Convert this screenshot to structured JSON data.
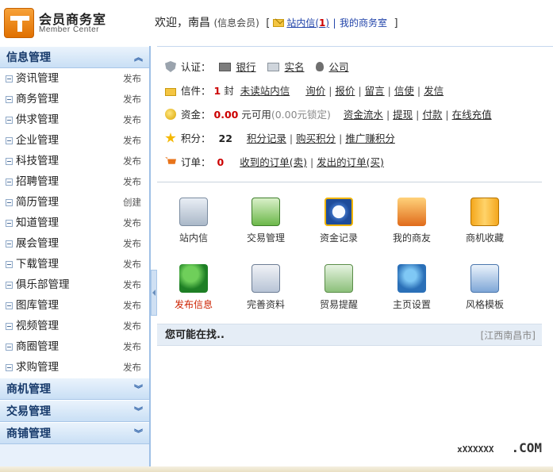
{
  "header": {
    "logo_title": "会员商务室",
    "logo_sub": "Member Center",
    "welcome_prefix": "欢迎，",
    "username": "南昌",
    "role": "(信息会员)",
    "bracket_open": "[",
    "bracket_close": "]",
    "inbox_label": "站内信(",
    "inbox_count": "1",
    "inbox_close": ")",
    "sep": "|",
    "office_link": "我的商务室"
  },
  "sidebar": {
    "sections": [
      {
        "title": "信息管理",
        "expanded": true,
        "items": [
          {
            "label": "资讯管理",
            "action": "发布"
          },
          {
            "label": "商务管理",
            "action": "发布"
          },
          {
            "label": "供求管理",
            "action": "发布"
          },
          {
            "label": "企业管理",
            "action": "发布"
          },
          {
            "label": "科技管理",
            "action": "发布"
          },
          {
            "label": "招聘管理",
            "action": "发布"
          },
          {
            "label": "简历管理",
            "action": "创建"
          },
          {
            "label": "知道管理",
            "action": "发布"
          },
          {
            "label": "展会管理",
            "action": "发布"
          },
          {
            "label": "下载管理",
            "action": "发布"
          },
          {
            "label": "俱乐部管理",
            "action": "发布"
          },
          {
            "label": "图库管理",
            "action": "发布"
          },
          {
            "label": "视频管理",
            "action": "发布"
          },
          {
            "label": "商圈管理",
            "action": "发布"
          },
          {
            "label": "求购管理",
            "action": "发布"
          }
        ]
      },
      {
        "title": "商机管理",
        "expanded": false
      },
      {
        "title": "交易管理",
        "expanded": false
      },
      {
        "title": "商铺管理",
        "expanded": false
      }
    ]
  },
  "account": {
    "cert": {
      "label": "认证：",
      "links": [
        "银行",
        "实名",
        "公司"
      ]
    },
    "mail": {
      "label": "信件：",
      "count": "1",
      "unit": "封",
      "links": [
        "未读站内信",
        "询价",
        "报价",
        "留言",
        "信使",
        "发信"
      ]
    },
    "funds": {
      "label": "资金：",
      "amount": "0.00",
      "unit": "元可用",
      "locked": "(0.00元锁定)",
      "links": [
        "资金流水",
        "提现",
        "付款",
        "在线充值"
      ]
    },
    "points": {
      "label": "积分：",
      "value": "22",
      "links": [
        "积分记录",
        "购买积分",
        "推广赚积分"
      ]
    },
    "orders": {
      "label": "订单：",
      "count": "0",
      "links": [
        "收到的订单(卖)",
        "发出的订单(买)"
      ]
    }
  },
  "tiles": [
    {
      "label": "站内信",
      "icon": "inbox-icon"
    },
    {
      "label": "交易管理",
      "icon": "trade-icon"
    },
    {
      "label": "资金记录",
      "icon": "money-clock-icon"
    },
    {
      "label": "我的商友",
      "icon": "friends-icon"
    },
    {
      "label": "商机收藏",
      "icon": "cabinet-icon"
    },
    {
      "label": "发布信息",
      "icon": "publish-user-icon"
    },
    {
      "label": "完善资料",
      "icon": "profile-edit-icon"
    },
    {
      "label": "贸易提醒",
      "icon": "remind-icon"
    },
    {
      "label": "主页设置",
      "icon": "home-globe-icon"
    },
    {
      "label": "风格模板",
      "icon": "template-icon"
    }
  ],
  "suggest": {
    "title": "您可能在找..",
    "location": "[江西南昌市]"
  },
  "watermark": {
    "small": "xXXXXXX",
    "big": ".COM"
  }
}
